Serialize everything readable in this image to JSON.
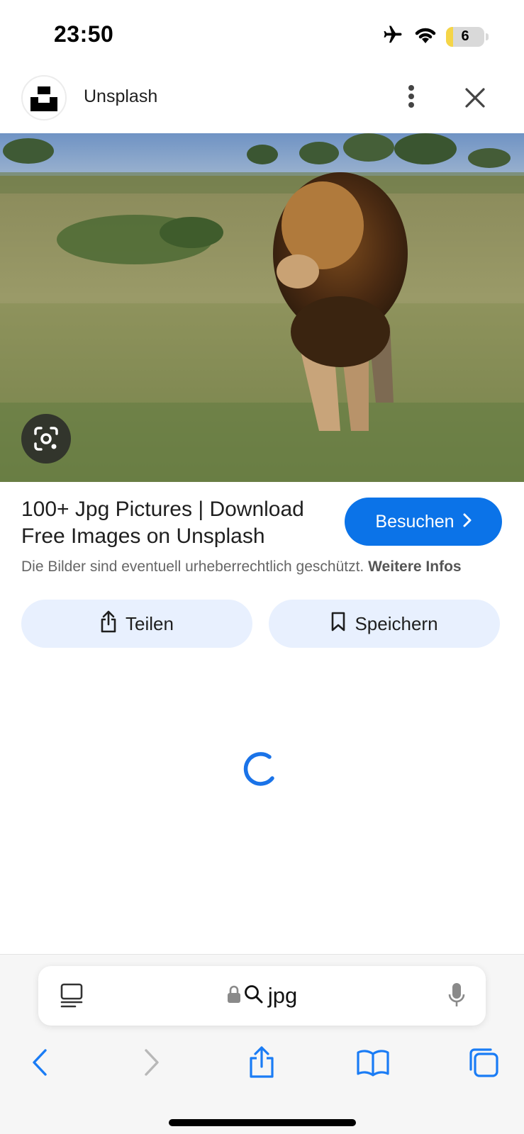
{
  "status_bar": {
    "time": "23:50",
    "battery_level": "6",
    "icons": [
      "airplane-icon",
      "wifi-icon",
      "battery-icon"
    ]
  },
  "header": {
    "site_name": "Unsplash",
    "icons": [
      "unsplash-logo",
      "more-vert-icon",
      "close-icon"
    ]
  },
  "image": {
    "subject": "lion in grassland",
    "lens_icon": "google-lens-icon"
  },
  "result": {
    "title": "100+ Jpg Pictures | Download Free Images on Unsplash",
    "visit_label": "Besuchen",
    "copyright_text": "Die Bilder sind eventuell urheberrechtlich geschützt.",
    "more_info_label": "Weitere Infos",
    "share_label": "Teilen",
    "save_label": "Speichern"
  },
  "browser": {
    "url_text": "jpg",
    "nav_icons": [
      "back-icon",
      "forward-icon",
      "share-icon",
      "bookmarks-icon",
      "tabs-icon"
    ]
  },
  "colors": {
    "accent": "#0b73e8",
    "pill_bg": "#e8f0fe",
    "ios_blue": "#1a7cf5",
    "spinner": "#1a73e8"
  }
}
